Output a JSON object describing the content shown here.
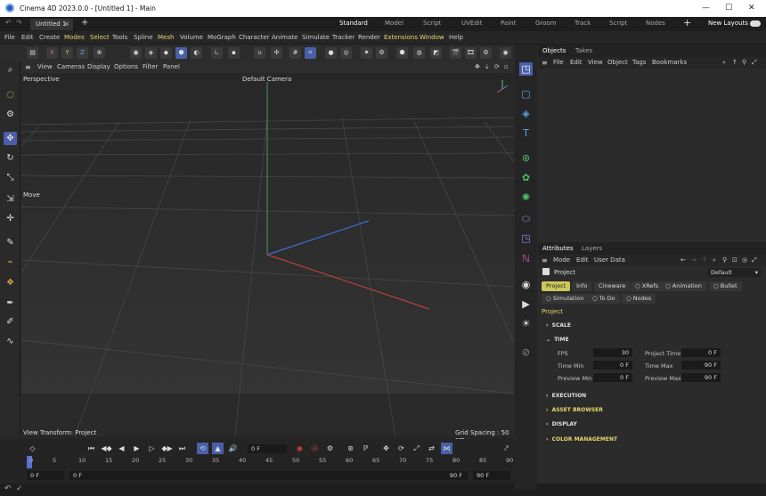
{
  "app": {
    "title": "Cinema 4D 2023.0.0 - [Untitled 1] - Main",
    "doc_tab": "Untitled 1",
    "layouts": [
      "Standard",
      "Model",
      "Script",
      "UVEdit",
      "Paint",
      "Groom",
      "Track",
      "Script",
      "Nodes"
    ],
    "new_layouts": "New Layouts"
  },
  "menu": [
    "File",
    "Edit",
    "Create",
    "Modes",
    "Select",
    "Tools",
    "Spline",
    "Mesh",
    "Volume",
    "MoGraph",
    "Character",
    "Animate",
    "Simulate",
    "Tracker",
    "Render",
    "Extensions",
    "Window",
    "Help"
  ],
  "toolbar": {
    "x": "X",
    "y": "Y",
    "z": "Z"
  },
  "viewport": {
    "menu": [
      "View",
      "Cameras",
      "Display",
      "Options",
      "Filter",
      "Panel"
    ],
    "name": "Perspective",
    "camera": "Default Camera",
    "tool": "Move",
    "view_transform": "View Transform: Project",
    "grid_spacing": "Grid Spacing : 50 cm"
  },
  "timeline": {
    "current": "0 F",
    "start": "0 F",
    "start2": "0 F",
    "end": "90 F",
    "end2": "90 F",
    "ticks": [
      "0",
      "5",
      "10",
      "15",
      "20",
      "25",
      "30",
      "35",
      "40",
      "45",
      "50",
      "55",
      "60",
      "65",
      "70",
      "75",
      "80",
      "85",
      "90"
    ]
  },
  "objects": {
    "tabs": [
      "Objects",
      "Takes"
    ],
    "menu": [
      "File",
      "Edit",
      "View",
      "Object",
      "Tags",
      "Bookmarks"
    ]
  },
  "attributes": {
    "tabs": [
      "Attributes",
      "Layers"
    ],
    "menu": [
      "Mode",
      "Edit",
      "User Data"
    ],
    "object": "Project",
    "preset": "Default",
    "chips_row1": [
      "Project",
      "Info",
      "Cineware",
      "XRefs",
      "Animation",
      "Bullet"
    ],
    "chips_row2": [
      "Simulation",
      "To Do",
      "Nodes"
    ],
    "heading": "Project",
    "sections": {
      "scale": "SCALE",
      "time": "TIME",
      "execution": "EXECUTION",
      "asset_browser": "ASSET BROWSER",
      "display": "DISPLAY",
      "color_management": "COLOR MANAGEMENT"
    },
    "time": {
      "fps_label": "FPS",
      "fps": "30",
      "project_time_label": "Project Time",
      "project_time": "0 F",
      "time_min_label": "Time Min",
      "time_min": "0 F",
      "time_max_label": "Time Max",
      "time_max": "90 F",
      "preview_min_label": "Preview Min",
      "preview_min": "0 F",
      "preview_max_label": "Preview Max",
      "preview_max": "90 F"
    }
  },
  "colors": {
    "accent": "#4b5fa8",
    "highlight": "#cbc85a",
    "menu_hl": "#e8d86a"
  }
}
